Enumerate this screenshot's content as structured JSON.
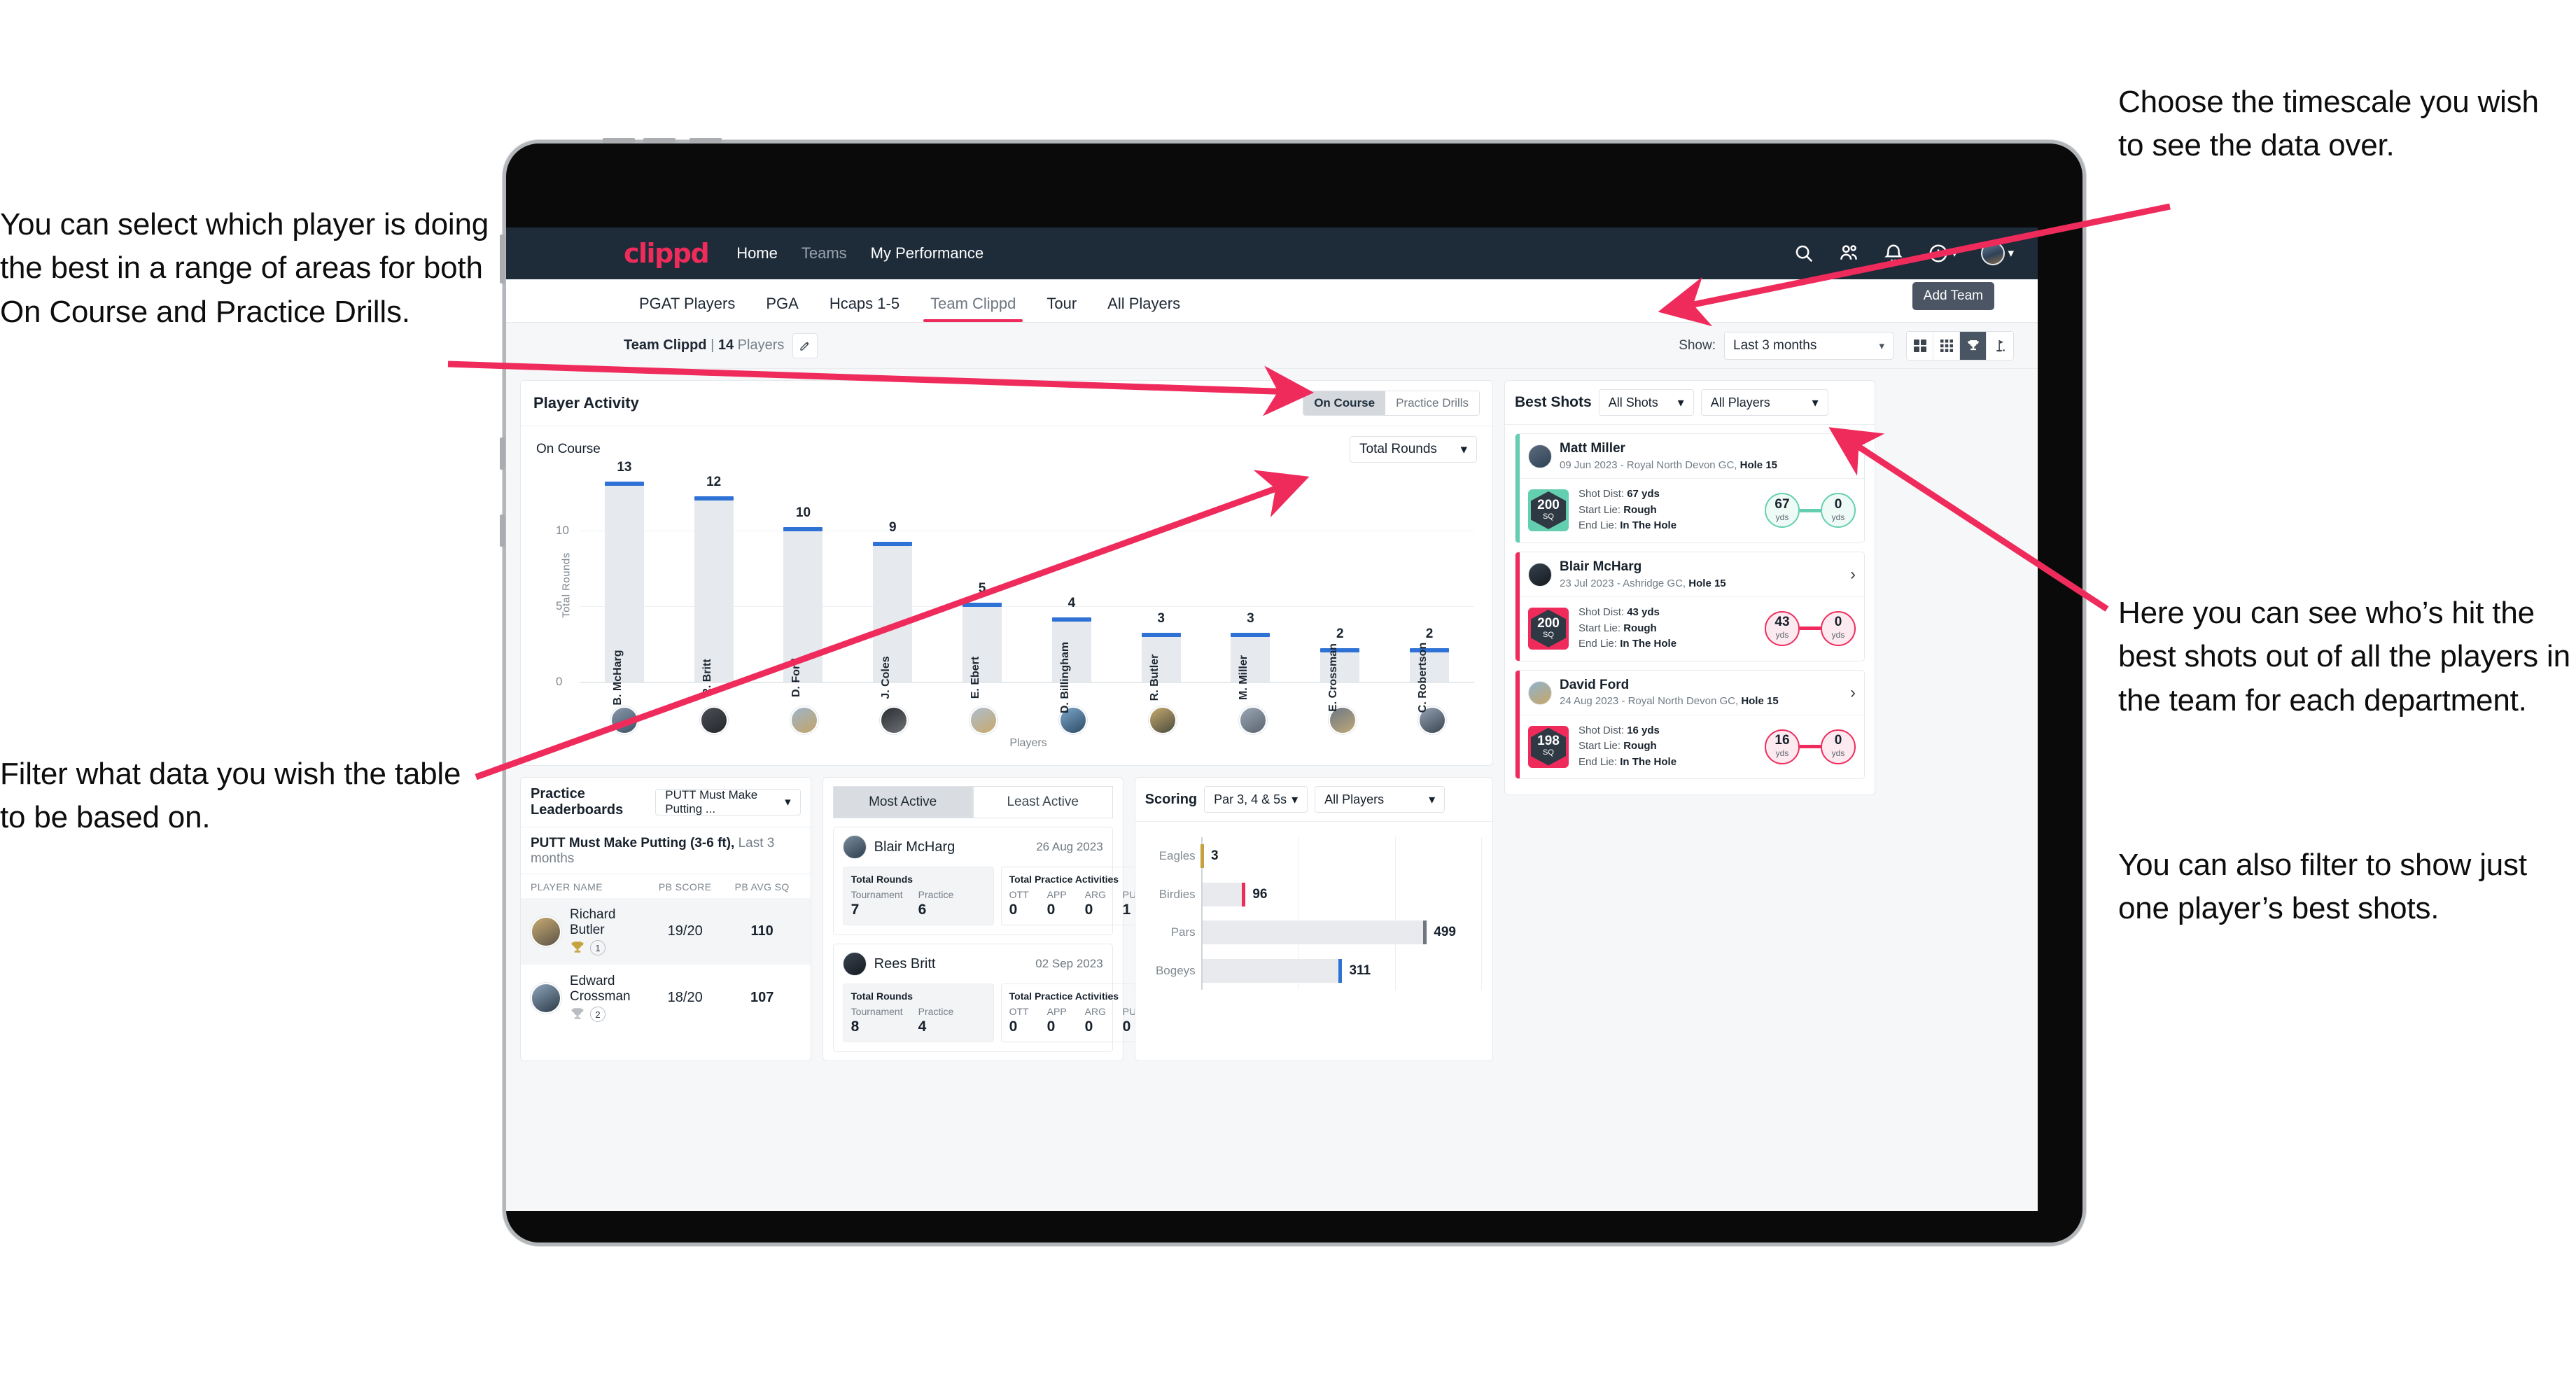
{
  "annotations": {
    "select_player": "You can select which player is doing the best in a range of areas for both On Course and Practice Drills.",
    "filter_data": "Filter what data you wish the table to be based on.",
    "timescale": "Choose the timescale you wish to see the data over.",
    "best_shots": "Here you can see who’s hit the best shots out of all the players in the team for each department.",
    "filter_one_player": "You can also filter to show just one player’s best shots."
  },
  "topnav": {
    "logo": "clippd",
    "links": [
      {
        "label": "Home",
        "active": true
      },
      {
        "label": "Teams",
        "active": false
      },
      {
        "label": "My Performance",
        "active": true
      }
    ],
    "icons": [
      "search-icon",
      "people-icon",
      "bell-icon",
      "plus-circle-icon",
      "avatar-icon"
    ],
    "bg": "#1e2b38",
    "accent": "#ef2b5c"
  },
  "tabs": {
    "items": [
      "PGAT Players",
      "PGA",
      "Hcaps 1-5",
      "Team Clippd",
      "Tour",
      "All Players"
    ],
    "active": "Team Clippd",
    "tooltip": "Add Team"
  },
  "subbar": {
    "team_name": "Team Clippd",
    "separator": "|",
    "player_count": "14",
    "player_word": "Players",
    "edit_icon": "pencil-icon",
    "show_label": "Show:",
    "timescale_value": "Last 3 months",
    "view_toggles": [
      "grid-2x2-icon",
      "grid-3x3-icon",
      "trophy-icon",
      "golf-flag-icon"
    ],
    "active_toggle": "trophy-icon"
  },
  "player_activity": {
    "title": "Player Activity",
    "segments": [
      "On Course",
      "Practice Drills"
    ],
    "segment_active": "On Course",
    "section_label": "On Course",
    "metric_select": "Total Rounds"
  },
  "chart_data": {
    "type": "bar",
    "title": "Player Activity – On Course",
    "xlabel": "Players",
    "ylabel": "Total Rounds",
    "ylim": [
      0,
      14
    ],
    "yticks": [
      0,
      5,
      10
    ],
    "grid": true,
    "categories": [
      "B. McHarg",
      "R. Britt",
      "D. Ford",
      "J. Coles",
      "E. Ebert",
      "D. Billingham",
      "R. Butler",
      "M. Miller",
      "E. Crossman",
      "C. Robertson"
    ],
    "values": [
      13,
      12,
      10,
      9,
      5,
      4,
      3,
      3,
      2,
      2
    ],
    "bar_color": "#e6e9ed",
    "cap_color": "#2f72d6"
  },
  "best_shots": {
    "title": "Best Shots",
    "shot_filter": "All Shots",
    "player_filter": "All Players",
    "cards": [
      {
        "name": "Matt Miller",
        "meta_date": "09 Jun 2023",
        "meta_course": "Royal North Devon GC,",
        "meta_hole": "Hole 15",
        "sq_value": "200",
        "sq_unit": "SQ",
        "accent": "#64cfb0",
        "shot_dist_label": "Shot Dist:",
        "shot_dist": "67 yds",
        "start_lie_label": "Start Lie:",
        "start_lie": "Rough",
        "end_lie_label": "End Lie:",
        "end_lie": "In The Hole",
        "from_value": "67",
        "from_unit": "yds",
        "to_value": "0",
        "to_unit": "yds"
      },
      {
        "name": "Blair McHarg",
        "meta_date": "23 Jul 2023",
        "meta_course": "Ashridge GC,",
        "meta_hole": "Hole 15",
        "sq_value": "200",
        "sq_unit": "SQ",
        "accent": "#ef2b5c",
        "shot_dist_label": "Shot Dist:",
        "shot_dist": "43 yds",
        "start_lie_label": "Start Lie:",
        "start_lie": "Rough",
        "end_lie_label": "End Lie:",
        "end_lie": "In The Hole",
        "from_value": "43",
        "from_unit": "yds",
        "to_value": "0",
        "to_unit": "yds"
      },
      {
        "name": "David Ford",
        "meta_date": "24 Aug 2023",
        "meta_course": "Royal North Devon GC,",
        "meta_hole": "Hole 15",
        "sq_value": "198",
        "sq_unit": "SQ",
        "accent": "#ef2b5c",
        "shot_dist_label": "Shot Dist:",
        "shot_dist": "16 yds",
        "start_lie_label": "Start Lie:",
        "start_lie": "Rough",
        "end_lie_label": "End Lie:",
        "end_lie": "In The Hole",
        "from_value": "16",
        "from_unit": "yds",
        "to_value": "0",
        "to_unit": "yds"
      }
    ]
  },
  "practice_leaderboards": {
    "title": "Practice Leaderboards",
    "drill_select": "PUTT Must Make Putting ...",
    "subtitle_bold": "PUTT Must Make Putting (3-6 ft),",
    "subtitle_grey": "Last 3 months",
    "columns": [
      "PLAYER NAME",
      "PB SCORE",
      "PB AVG SQ"
    ],
    "rows": [
      {
        "name": "Richard Butler",
        "rank": "1",
        "trophy": "gold",
        "pb_score": "19/20",
        "pb_avg_sq": "110"
      },
      {
        "name": "Edward Crossman",
        "rank": "2",
        "trophy": "silver",
        "pb_score": "18/20",
        "pb_avg_sq": "107"
      }
    ]
  },
  "activity_panel": {
    "tabs": [
      "Most Active",
      "Least Active"
    ],
    "active_tab": "Most Active",
    "rounds_title": "Total Rounds",
    "rounds_keys": [
      "Tournament",
      "Practice"
    ],
    "practice_title": "Total Practice Activities",
    "practice_keys": [
      "OTT",
      "APP",
      "ARG",
      "PUTT"
    ],
    "cards": [
      {
        "name": "Blair McHarg",
        "date": "26 Aug 2023",
        "rounds": [
          "7",
          "6"
        ],
        "practice": [
          "0",
          "0",
          "0",
          "1"
        ]
      },
      {
        "name": "Rees Britt",
        "date": "02 Sep 2023",
        "rounds": [
          "8",
          "4"
        ],
        "practice": [
          "0",
          "0",
          "0",
          "0"
        ]
      }
    ]
  },
  "scoring": {
    "title": "Scoring",
    "par_filter": "Par 3, 4 & 5s",
    "player_filter": "All Players",
    "chart": {
      "type": "bar",
      "orientation": "horizontal",
      "categories": [
        "Eagles",
        "Birdies",
        "Pars",
        "Bogeys"
      ],
      "values": [
        3,
        96,
        499,
        311
      ],
      "colors": [
        "#c5a23f",
        "#ef2b5c",
        "#6f7680",
        "#2f72d6"
      ],
      "xmax": 620
    }
  }
}
